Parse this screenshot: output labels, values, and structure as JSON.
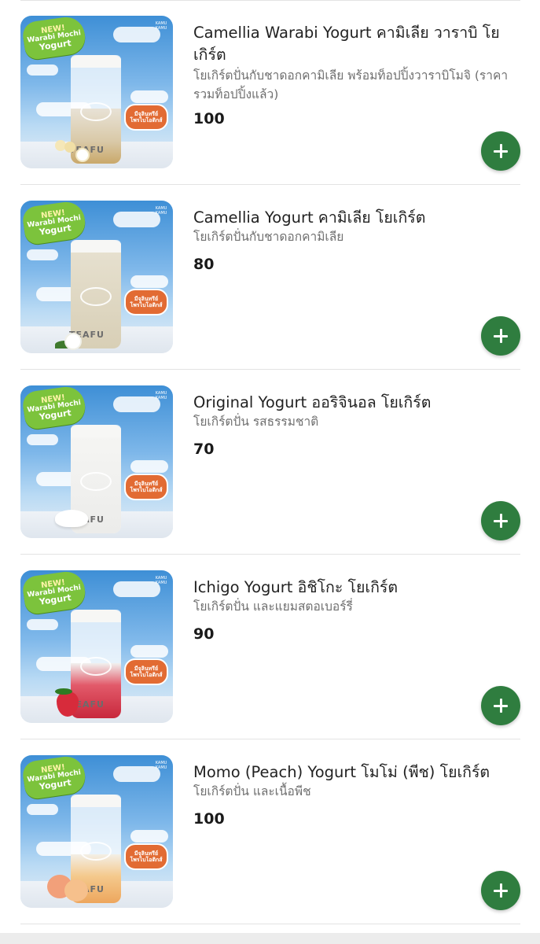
{
  "menu": {
    "add_button_icon": "plus-icon",
    "accent_color": "#2f7d3f",
    "thumbnail_text": {
      "badge_new": "NEW!",
      "badge_line2": "Warabi Mochi",
      "badge_line3": "Yogurt",
      "brand_vertical": "KAMU KAMU",
      "cup_brand": "TEAFU",
      "promo_line1": "มีจุลินทรีย์",
      "promo_line2": "โพรไบโอติกส์"
    },
    "items": [
      {
        "name": "Camellia Warabi Yogurt คามิเลีย วาราบิ โยเกิร์ต",
        "description": "โยเกิร์ตปั่นกับชาดอกคามิเลีย พร้อมท็อปปิ้งวาราบิโมจิ (ราคารวมท็อปปิ้งแล้ว)",
        "price": "100"
      },
      {
        "name": "Camellia Yogurt คามิเลีย โยเกิร์ต",
        "description": "โยเกิร์ตปั่นกับชาดอกคามิเลีย",
        "price": "80"
      },
      {
        "name": "Original Yogurt ออริจินอล โยเกิร์ต",
        "description": "โยเกิร์ตปั่น รสธรรมชาติ",
        "price": "70"
      },
      {
        "name": "Ichigo Yogurt อิชิโกะ โยเกิร์ต",
        "description": "โยเกิร์ตปั่น และแยมสตอเบอร์รี่",
        "price": "90"
      },
      {
        "name": "Momo (Peach) Yogurt โมโม่ (พีช) โยเกิร์ต",
        "description": "โยเกิร์ตปั่น และเนื้อพีช",
        "price": "100"
      }
    ]
  }
}
